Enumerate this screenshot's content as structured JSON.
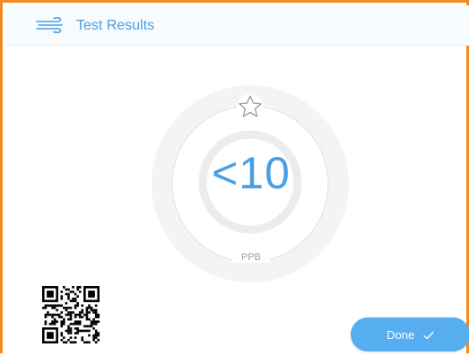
{
  "header": {
    "title": "Test Results",
    "icon": "wind-icon"
  },
  "result": {
    "value": "<10",
    "unit": "PPB",
    "rating_icon": "star-outline-icon"
  },
  "actions": {
    "done_label": "Done",
    "done_icon": "checkmark-icon"
  },
  "colors": {
    "accent": "#4a9fe3",
    "button": "#56aef0",
    "frame_border": "#f08a24",
    "ring": "#ececec"
  }
}
